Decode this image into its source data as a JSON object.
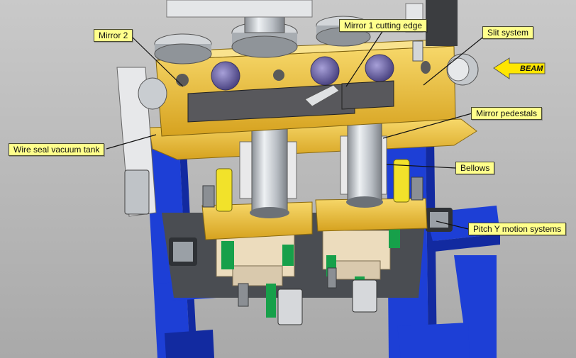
{
  "labels": {
    "mirror2": "Mirror 2",
    "mirror1_cutting_edge": "Mirror 1 cutting edge",
    "slit_system": "Slit system",
    "beam": "BEAM",
    "mirror_pedestals": "Mirror pedestals",
    "wire_seal_vacuum_tank": "Wire seal vacuum tank",
    "bellows": "Bellows",
    "pitch_y_motion_systems": "Pitch Y motion systems"
  },
  "colors": {
    "frame_blue": "#1d3fd6",
    "tank_gold": "#f0c53c",
    "callout_fill": "#ffff8c",
    "background": "#b9b9b9"
  }
}
